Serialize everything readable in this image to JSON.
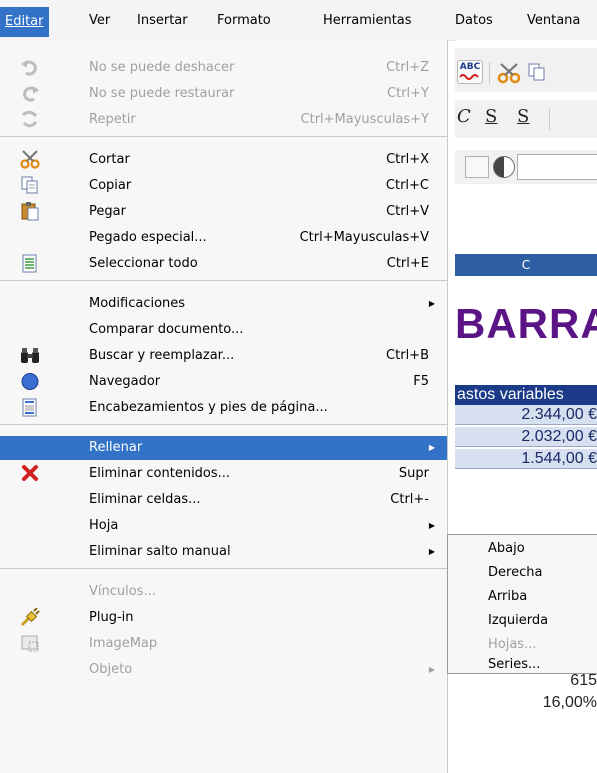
{
  "menubar": {
    "items": [
      {
        "label": "Editar",
        "active": true
      },
      {
        "label": "Ver",
        "active": false
      },
      {
        "label": "Insertar",
        "active": false
      },
      {
        "label": "Formato",
        "active": false
      },
      {
        "label": "Herramientas",
        "active": false
      },
      {
        "label": "Datos",
        "active": false
      },
      {
        "label": "Ventana",
        "active": false
      }
    ]
  },
  "colors": {
    "highlight": "#3273c7",
    "title": "#5a1486",
    "header": "#2f5ea5"
  },
  "edit_menu": {
    "items": [
      {
        "label": "No se puede deshacer",
        "shortcut": "Ctrl+Z",
        "icon": "undo-icon",
        "disabled": true
      },
      {
        "label": "No se puede restaurar",
        "shortcut": "Ctrl+Y",
        "icon": "redo-icon",
        "disabled": true
      },
      {
        "label": "Repetir",
        "shortcut": "Ctrl+Mayusculas+Y",
        "icon": "repeat-icon",
        "disabled": true
      },
      {
        "label": "Cortar",
        "shortcut": "Ctrl+X",
        "icon": "scissors-icon",
        "disabled": false
      },
      {
        "label": "Copiar",
        "shortcut": "Ctrl+C",
        "icon": "copy-icon",
        "disabled": false
      },
      {
        "label": "Pegar",
        "shortcut": "Ctrl+V",
        "icon": "paste-icon",
        "disabled": false
      },
      {
        "label": "Pegado especial...",
        "shortcut": "Ctrl+Mayusculas+V",
        "icon": "",
        "disabled": false
      },
      {
        "label": "Seleccionar todo",
        "shortcut": "Ctrl+E",
        "icon": "select-all-icon",
        "disabled": false
      },
      {
        "label": "Modificaciones",
        "shortcut": "",
        "icon": "",
        "disabled": false,
        "submenu": true
      },
      {
        "label": "Comparar documento...",
        "shortcut": "",
        "icon": "",
        "disabled": false
      },
      {
        "label": "Buscar y reemplazar...",
        "shortcut": "Ctrl+B",
        "icon": "binoculars-icon",
        "disabled": false
      },
      {
        "label": "Navegador",
        "shortcut": "F5",
        "icon": "compass-icon",
        "disabled": false
      },
      {
        "label": "Encabezamientos y pies de página...",
        "shortcut": "",
        "icon": "header-footer-icon",
        "disabled": false
      },
      {
        "label": "Rellenar",
        "shortcut": "",
        "icon": "",
        "disabled": false,
        "submenu": true,
        "highlighted": true
      },
      {
        "label": "Eliminar contenidos...",
        "shortcut": "Supr",
        "icon": "delete-x-icon",
        "disabled": false
      },
      {
        "label": "Eliminar celdas...",
        "shortcut": "Ctrl+-",
        "icon": "",
        "disabled": false
      },
      {
        "label": "Hoja",
        "shortcut": "",
        "icon": "",
        "disabled": false,
        "submenu": true
      },
      {
        "label": "Eliminar salto manual",
        "shortcut": "",
        "icon": "",
        "disabled": false,
        "submenu": true
      },
      {
        "label": "Vínculos...",
        "shortcut": "",
        "icon": "",
        "disabled": true
      },
      {
        "label": "Plug-in",
        "shortcut": "",
        "icon": "plugin-icon",
        "disabled": false
      },
      {
        "label": "ImageMap",
        "shortcut": "",
        "icon": "imagemap-icon",
        "disabled": true
      },
      {
        "label": "Objeto",
        "shortcut": "",
        "icon": "",
        "disabled": true,
        "submenu": true
      }
    ]
  },
  "fill_submenu": {
    "items": [
      {
        "label": "Abajo",
        "disabled": false
      },
      {
        "label": "Derecha",
        "disabled": false
      },
      {
        "label": "Arriba",
        "disabled": false
      },
      {
        "label": "Izquierda",
        "disabled": false
      },
      {
        "label": "Hojas...",
        "disabled": true
      },
      {
        "label": "Series...",
        "disabled": false
      }
    ]
  },
  "spreadsheet": {
    "toolbar": {
      "spellcheck_label": "ABC",
      "format_letters": [
        "C",
        "S",
        "S"
      ]
    },
    "column_header": "C",
    "title_text": "BARRA",
    "cells": [
      "astos variables",
      "2.344,00 €",
      "2.032,00 €",
      "1.544,00 €",
      "615",
      "16,00%"
    ]
  }
}
